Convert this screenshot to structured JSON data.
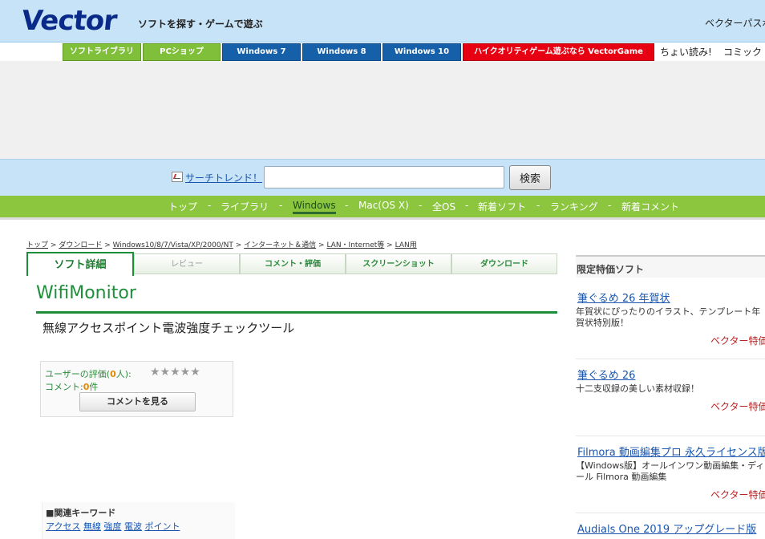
{
  "header": {
    "logo": "Vector",
    "tagline": "ソフトを探す・ゲームで遊ぶ",
    "passport": "ベクターパスポ"
  },
  "nav_buttons": [
    {
      "label": "ソフトライブラリ",
      "color": "#7fbf3a"
    },
    {
      "label": "PCショップ",
      "color": "#7fbf3a"
    },
    {
      "label": "Windows 7",
      "color": "#1560a8"
    },
    {
      "label": "Windows 8",
      "color": "#1560a8"
    },
    {
      "label": "Windows 10",
      "color": "#1560a8"
    },
    {
      "label": "ハイクオリティゲーム遊ぶなら VectorGame",
      "color": "#e60012"
    }
  ],
  "text_links": [
    "ちょい読み!",
    "コミック"
  ],
  "search": {
    "trend_label": "サーチトレンド！",
    "input_value": "",
    "button_label": "検索"
  },
  "category_nav": {
    "items": [
      "トップ",
      "ライブラリ",
      "Windows",
      "Mac(OS X)",
      "全OS",
      "新着ソフト",
      "ランキング",
      "新着コメント"
    ],
    "active": "Windows",
    "separator": "-"
  },
  "breadcrumb": [
    "トップ",
    "ダウンロード",
    "Windows10/8/7/Vista/XP/2000/NT",
    "インターネット＆通信",
    "LAN・Internet等",
    "LAN用"
  ],
  "breadcrumb_sep": ">",
  "tabs": [
    {
      "label": "ソフト詳細",
      "state": "active"
    },
    {
      "label": "レビュー",
      "state": "disabled"
    },
    {
      "label": "コメント・評価",
      "state": "normal"
    },
    {
      "label": "スクリーンショット",
      "state": "normal"
    },
    {
      "label": "ダウンロード",
      "state": "normal"
    }
  ],
  "software": {
    "title": "WifiMonitor",
    "subtitle": "無線アクセスポイント電波強度チェックツール"
  },
  "rating": {
    "label_prefix": "ユーザーの評価(",
    "count": "0",
    "label_suffix": "人):",
    "stars": "★★★★★",
    "comment_prefix": "コメント:",
    "comment_count": "0",
    "comment_suffix": "件",
    "button_label": "コメントを見る"
  },
  "keywords": {
    "title": "■関連キーワード",
    "items": [
      "アクセス",
      "無線",
      "強度",
      "電波",
      "ポイント"
    ]
  },
  "sidebar": {
    "heading": "限定特価ソフト",
    "items": [
      {
        "name": "筆ぐるめ 26 年賀状",
        "desc": "年賀状にぴったりのイラスト、テンプレート年賀状特別版！",
        "vendor": "ベクター特価"
      },
      {
        "name": "筆ぐるめ 26",
        "desc": "十二支収録の美しい素材収録！",
        "vendor": "ベクター特価"
      },
      {
        "name": "Filmora 動画編集プロ 永久ライセンス版",
        "desc": "【Windows版】オールインワン動画編集・ディール Filmora 動画編集",
        "vendor": "ベクター特価"
      },
      {
        "name": "Audials One 2019 アップグレード版",
        "desc": "",
        "vendor": ""
      }
    ]
  }
}
